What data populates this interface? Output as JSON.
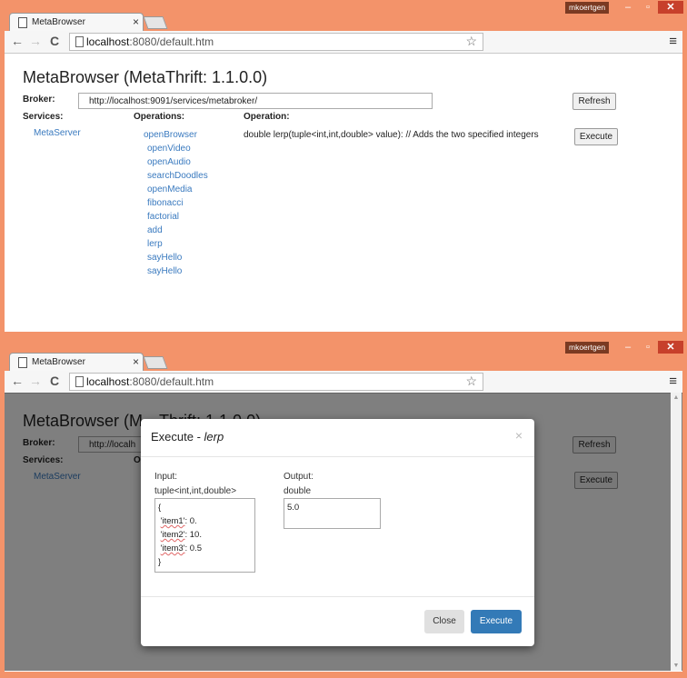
{
  "browser": {
    "user": "mkoertgen",
    "tab_title": "MetaBrowser",
    "url_host": "localhost",
    "url_path": ":8080/default.htm"
  },
  "app": {
    "title": "MetaBrowser (MetaThrift: 1.1.0.0)",
    "broker_label": "Broker:",
    "broker_url": "http://localhost:9091/services/metabroker/",
    "refresh_label": "Refresh",
    "services_label": "Services:",
    "operations_label": "Operations:",
    "operation_label": "Operation:",
    "execute_label": "Execute",
    "services": [
      "MetaServer"
    ],
    "operations": [
      "openBrowser",
      "openVideo",
      "openAudio",
      "searchDoodles",
      "openMedia",
      "fibonacci",
      "factorial",
      "add",
      "lerp",
      "sayHello",
      "sayHello"
    ],
    "operation_desc": "double lerp(tuple<int,int,double> value): // Adds the two specified integers"
  },
  "modal": {
    "title_prefix": "Execute - ",
    "title_op": "lerp",
    "input_label": "Input:",
    "input_type": "tuple<int,int,double>",
    "input_lines": {
      "open": "{",
      "k1": "'item1'",
      "v1": ": 0.",
      "k2": "'item2'",
      "v2": ": 10.",
      "k3": "'item3'",
      "v3": ": 0.5",
      "close": "}"
    },
    "output_label": "Output:",
    "output_type": "double",
    "output_value": "5.0",
    "close_label": "Close",
    "execute_label": "Execute",
    "dismiss_glyph": "×"
  },
  "partial_title": "MetaBrowser (M",
  "partial_title_tail": "Thrift: 1.1.0.0)",
  "partial_broker": "http://localh",
  "partial_op_char": "O"
}
